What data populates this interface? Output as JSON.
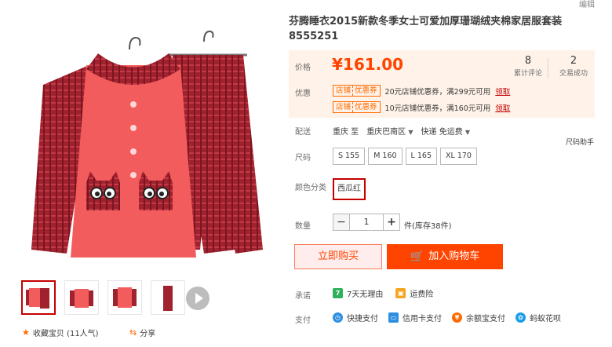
{
  "edit_label": "编辑",
  "title": "芬腾睡衣2015新款冬季女士可爱加厚珊瑚绒夹棉家居服套装8555251",
  "price": {
    "label": "价格",
    "value": "¥161.00",
    "reviews_count": "8",
    "reviews_label": "累计评论",
    "sales_count": "2",
    "sales_label": "交易成功"
  },
  "promo": {
    "label": "优惠",
    "coupons": [
      {
        "tag_left": "店铺",
        "tag_right": "优惠券",
        "text": "20元店铺优惠券，满299元可用",
        "link": "领取"
      },
      {
        "tag_left": "店铺",
        "tag_right": "优惠券",
        "text": "10元店铺优惠券，满160元可用",
        "link": "领取"
      }
    ]
  },
  "shipping": {
    "label": "配送",
    "from": "重庆 至",
    "to": "重庆巴南区",
    "method": "快递 免运费"
  },
  "size_helper": "尺码助手",
  "size": {
    "label": "尺码",
    "options": [
      "S 155",
      "M 160",
      "L 165",
      "XL 170"
    ]
  },
  "color": {
    "label": "颜色分类",
    "selected": "西瓜红"
  },
  "quantity": {
    "label": "数量",
    "value": "1",
    "minus": "−",
    "plus": "+",
    "stock": "件(库存38件)"
  },
  "buttons": {
    "buy_now": "立即购买",
    "add_cart": "加入购物车"
  },
  "promise": {
    "label": "承诺",
    "items": [
      "7天无理由",
      "运费险"
    ]
  },
  "payment": {
    "label": "支付",
    "items": [
      "快捷支付",
      "信用卡支付",
      "余额宝支付",
      "蚂蚁花呗"
    ]
  },
  "footer": {
    "collect": "收藏宝贝 (11人气)",
    "share": "分享"
  },
  "colors": {
    "accent": "#ff4400",
    "brand_red": "#c40000",
    "price_bg": "#fff2e8"
  },
  "icons": [
    "star-icon",
    "share-icon",
    "cart-icon",
    "play-icon",
    "seven-day-icon",
    "freight-icon",
    "quick-pay-icon",
    "credit-card-icon",
    "yuebao-icon",
    "huabei-icon"
  ]
}
